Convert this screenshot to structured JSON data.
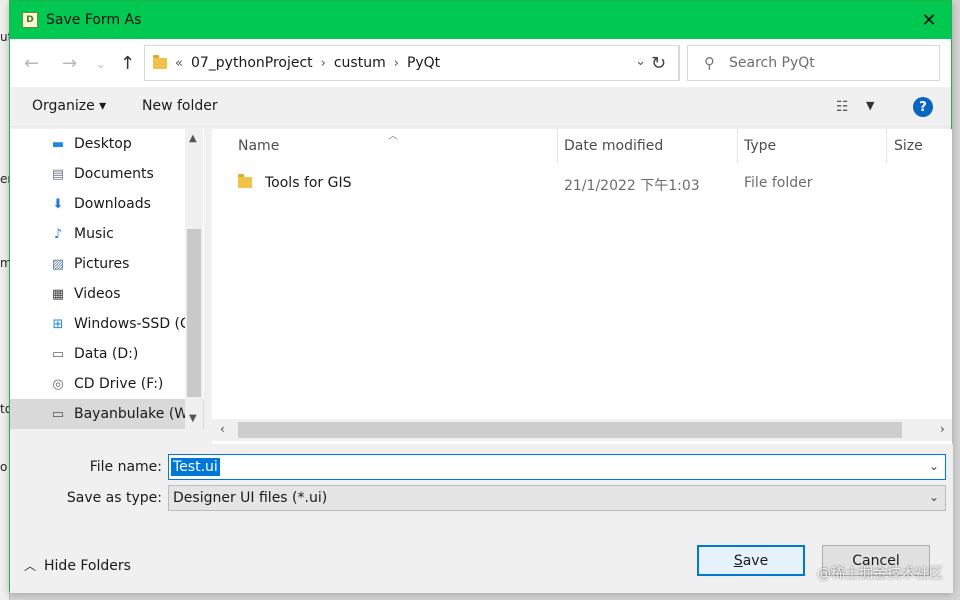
{
  "window": {
    "title": "Save Form As",
    "app_icon_letter": "D"
  },
  "background_peek": {
    "fragments": [
      "ut",
      "er",
      "m",
      "to",
      "o"
    ]
  },
  "address_bar": {
    "crumbs": [
      "07_pythonProject",
      "custum",
      "PyQt"
    ],
    "overflow": "«",
    "search_placeholder": "Search PyQt"
  },
  "toolbar": {
    "organize_label": "Organize ▾",
    "new_folder_label": "New folder",
    "help": "?"
  },
  "nav_pane": {
    "items": [
      {
        "label": "Desktop",
        "icon": "desktop-icon",
        "glyph": "▬",
        "color": "#1e88e5"
      },
      {
        "label": "Documents",
        "icon": "documents-icon",
        "glyph": "▤",
        "color": "#6a7a8a"
      },
      {
        "label": "Downloads",
        "icon": "downloads-icon",
        "glyph": "⬇",
        "color": "#1e7ad6"
      },
      {
        "label": "Music",
        "icon": "music-icon",
        "glyph": "♪",
        "color": "#1e7ad6"
      },
      {
        "label": "Pictures",
        "icon": "pictures-icon",
        "glyph": "▨",
        "color": "#5a7aa0"
      },
      {
        "label": "Videos",
        "icon": "videos-icon",
        "glyph": "▦",
        "color": "#444444"
      },
      {
        "label": "Windows-SSD (C",
        "icon": "windows-drive-icon",
        "glyph": "⊞",
        "color": "#1e88e5"
      },
      {
        "label": "Data (D:)",
        "icon": "drive-icon",
        "glyph": "▭",
        "color": "#666666"
      },
      {
        "label": "CD Drive (F:)",
        "icon": "cd-drive-icon",
        "glyph": "◎",
        "color": "#666666"
      },
      {
        "label": "Bayanbulake (W:",
        "icon": "network-drive-icon",
        "glyph": "▭",
        "color": "#555555"
      }
    ],
    "selected_index": 9
  },
  "file_list": {
    "columns": [
      "Name",
      "Date modified",
      "Type",
      "Size"
    ],
    "rows": [
      {
        "name": "Tools for GIS",
        "date": "21/1/2022 下午1:03",
        "type": "File folder",
        "size": ""
      }
    ]
  },
  "form": {
    "file_name_label": "File name:",
    "file_name_value": "Test.ui",
    "save_type_label": "Save as type:",
    "save_type_value": "Designer UI files (*.ui)"
  },
  "footer": {
    "hide_folders_label": "Hide Folders",
    "save_label": "Save",
    "cancel_label": "Cancel"
  },
  "watermark": "@稀土掘金技术社区",
  "colors": {
    "titlebar": "#00c850",
    "accent": "#0078d7"
  }
}
